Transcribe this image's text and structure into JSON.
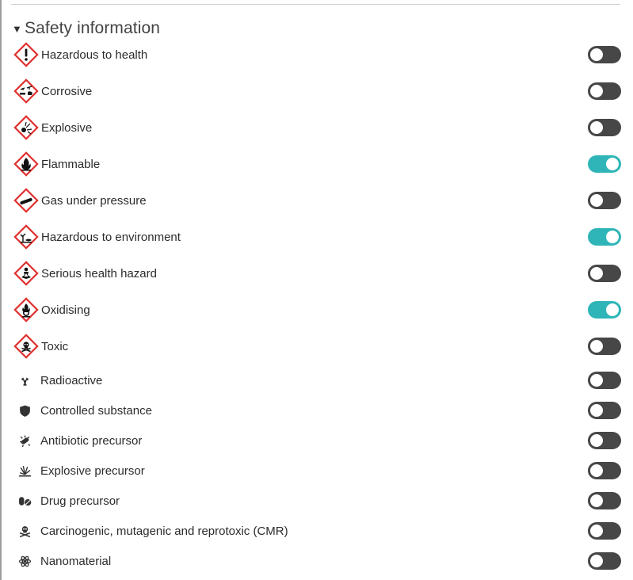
{
  "section": {
    "title": "Safety information",
    "expanded": true
  },
  "colors": {
    "toggle_on": "#2fb5b8",
    "toggle_off": "#474747",
    "ghs_border": "#e03030"
  },
  "ghs_items": [
    {
      "label": "Hazardous to health",
      "icon": "exclamation-mark-icon",
      "enabled": false
    },
    {
      "label": "Corrosive",
      "icon": "corrosive-icon",
      "enabled": false
    },
    {
      "label": "Explosive",
      "icon": "exploding-bomb-icon",
      "enabled": false
    },
    {
      "label": "Flammable",
      "icon": "flame-icon",
      "enabled": true
    },
    {
      "label": "Gas under pressure",
      "icon": "gas-cylinder-icon",
      "enabled": false
    },
    {
      "label": "Hazardous to environment",
      "icon": "environment-icon",
      "enabled": true
    },
    {
      "label": "Serious health hazard",
      "icon": "health-hazard-icon",
      "enabled": false
    },
    {
      "label": "Oxidising",
      "icon": "flame-over-circle-icon",
      "enabled": true
    },
    {
      "label": "Toxic",
      "icon": "skull-crossbones-icon",
      "enabled": false
    }
  ],
  "other_items": [
    {
      "label": "Radioactive",
      "icon": "radioactive-icon",
      "enabled": false
    },
    {
      "label": "Controlled substance",
      "icon": "shield-icon",
      "enabled": false
    },
    {
      "label": "Antibiotic precursor",
      "icon": "bacteria-icon",
      "enabled": false
    },
    {
      "label": "Explosive precursor",
      "icon": "explosion-icon",
      "enabled": false
    },
    {
      "label": "Drug precursor",
      "icon": "pills-icon",
      "enabled": false
    },
    {
      "label": "Carcinogenic, mutagenic and reprotoxic (CMR)",
      "icon": "skull-crossbones-icon",
      "enabled": false
    },
    {
      "label": "Nanomaterial",
      "icon": "atom-icon",
      "enabled": false
    }
  ]
}
